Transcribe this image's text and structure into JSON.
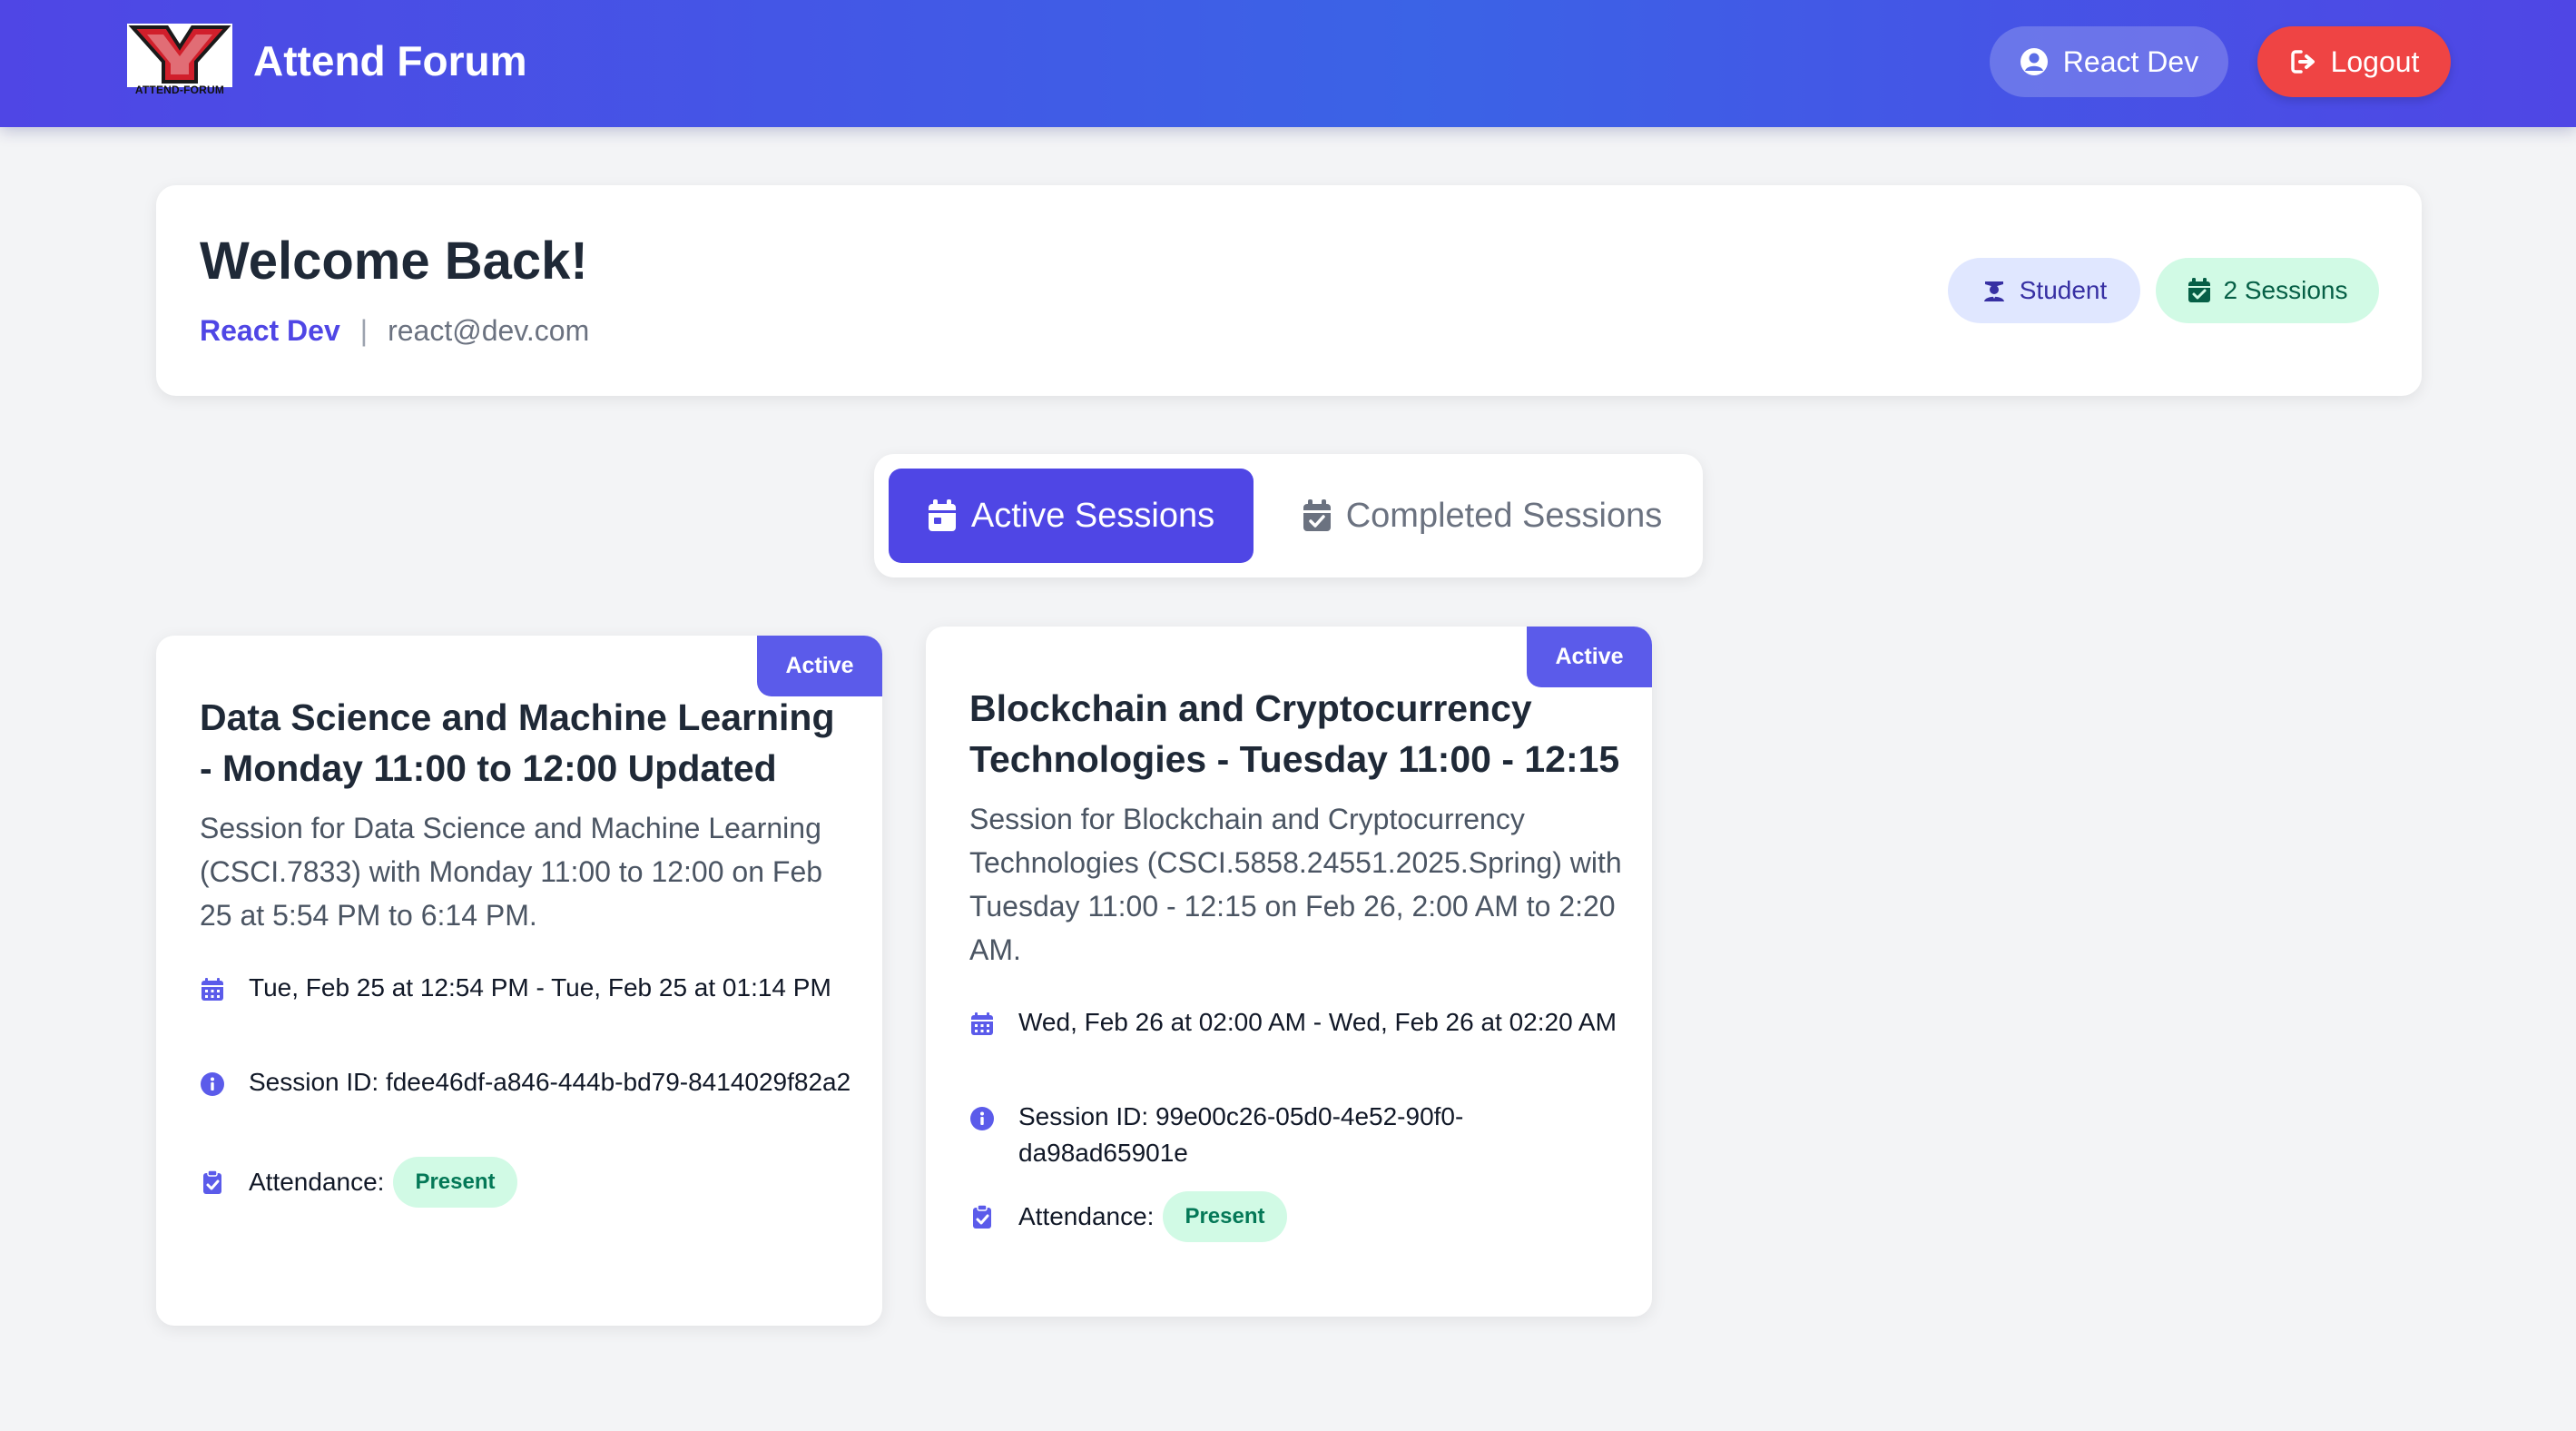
{
  "header": {
    "app_title": "Attend Forum",
    "logo_text": "ATTEND-FORUM",
    "user_button": "React Dev",
    "logout_button": "Logout"
  },
  "welcome": {
    "title": "Welcome Back!",
    "user_name": "React Dev",
    "separator": "|",
    "email": "react@dev.com",
    "role_badge": "Student",
    "sessions_badge": "2 Sessions"
  },
  "tabs": {
    "active": "Active Sessions",
    "completed": "Completed Sessions"
  },
  "sessions": [
    {
      "status": "Active",
      "title": "Data Science and Machine Learning - Monday 11:00 to 12:00 Updated",
      "description": "Session for Data Science and Machine Learning (CSCI.7833) with Monday 11:00 to 12:00 on Feb 25 at 5:54 PM to 6:14 PM.",
      "time_range": "Tue, Feb 25 at 12:54 PM - Tue, Feb 25 at 01:14 PM",
      "session_id": "Session ID: fdee46df-a846-444b-bd79-8414029f82a2",
      "attendance_label": "Attendance:",
      "attendance_value": "Present"
    },
    {
      "status": "Active",
      "title": "Blockchain and Cryptocurrency Technologies - Tuesday 11:00 - 12:15",
      "description": "Session for Blockchain and Cryptocurrency Technologies (CSCI.5858.24551.2025.Spring) with Tuesday 11:00 - 12:15 on Feb 26, 2:00 AM to 2:20 AM.",
      "time_range": "Wed, Feb 26 at 02:00 AM - Wed, Feb 26 at 02:20 AM",
      "session_id": "Session ID: 99e00c26-05d0-4e52-90f0-da98ad65901e",
      "attendance_label": "Attendance:",
      "attendance_value": "Present"
    }
  ],
  "colors": {
    "primary": "#4f46e5",
    "header_gradient": [
      "#4f46e5",
      "#3b63e6"
    ],
    "logout": "#ef4444",
    "present_bg": "#d1fae5",
    "present_text": "#047857",
    "status_tag": "#5b5bea"
  },
  "icons": {
    "user": "user-circle-icon",
    "logout": "sign-out-icon",
    "student": "user-graduate-icon",
    "sessions": "calendar-check-icon",
    "active_tab": "calendar-icon",
    "completed_tab": "calendar-check-icon",
    "time": "calendar-grid-icon",
    "id": "info-circle-icon",
    "attendance": "clipboard-check-icon"
  }
}
